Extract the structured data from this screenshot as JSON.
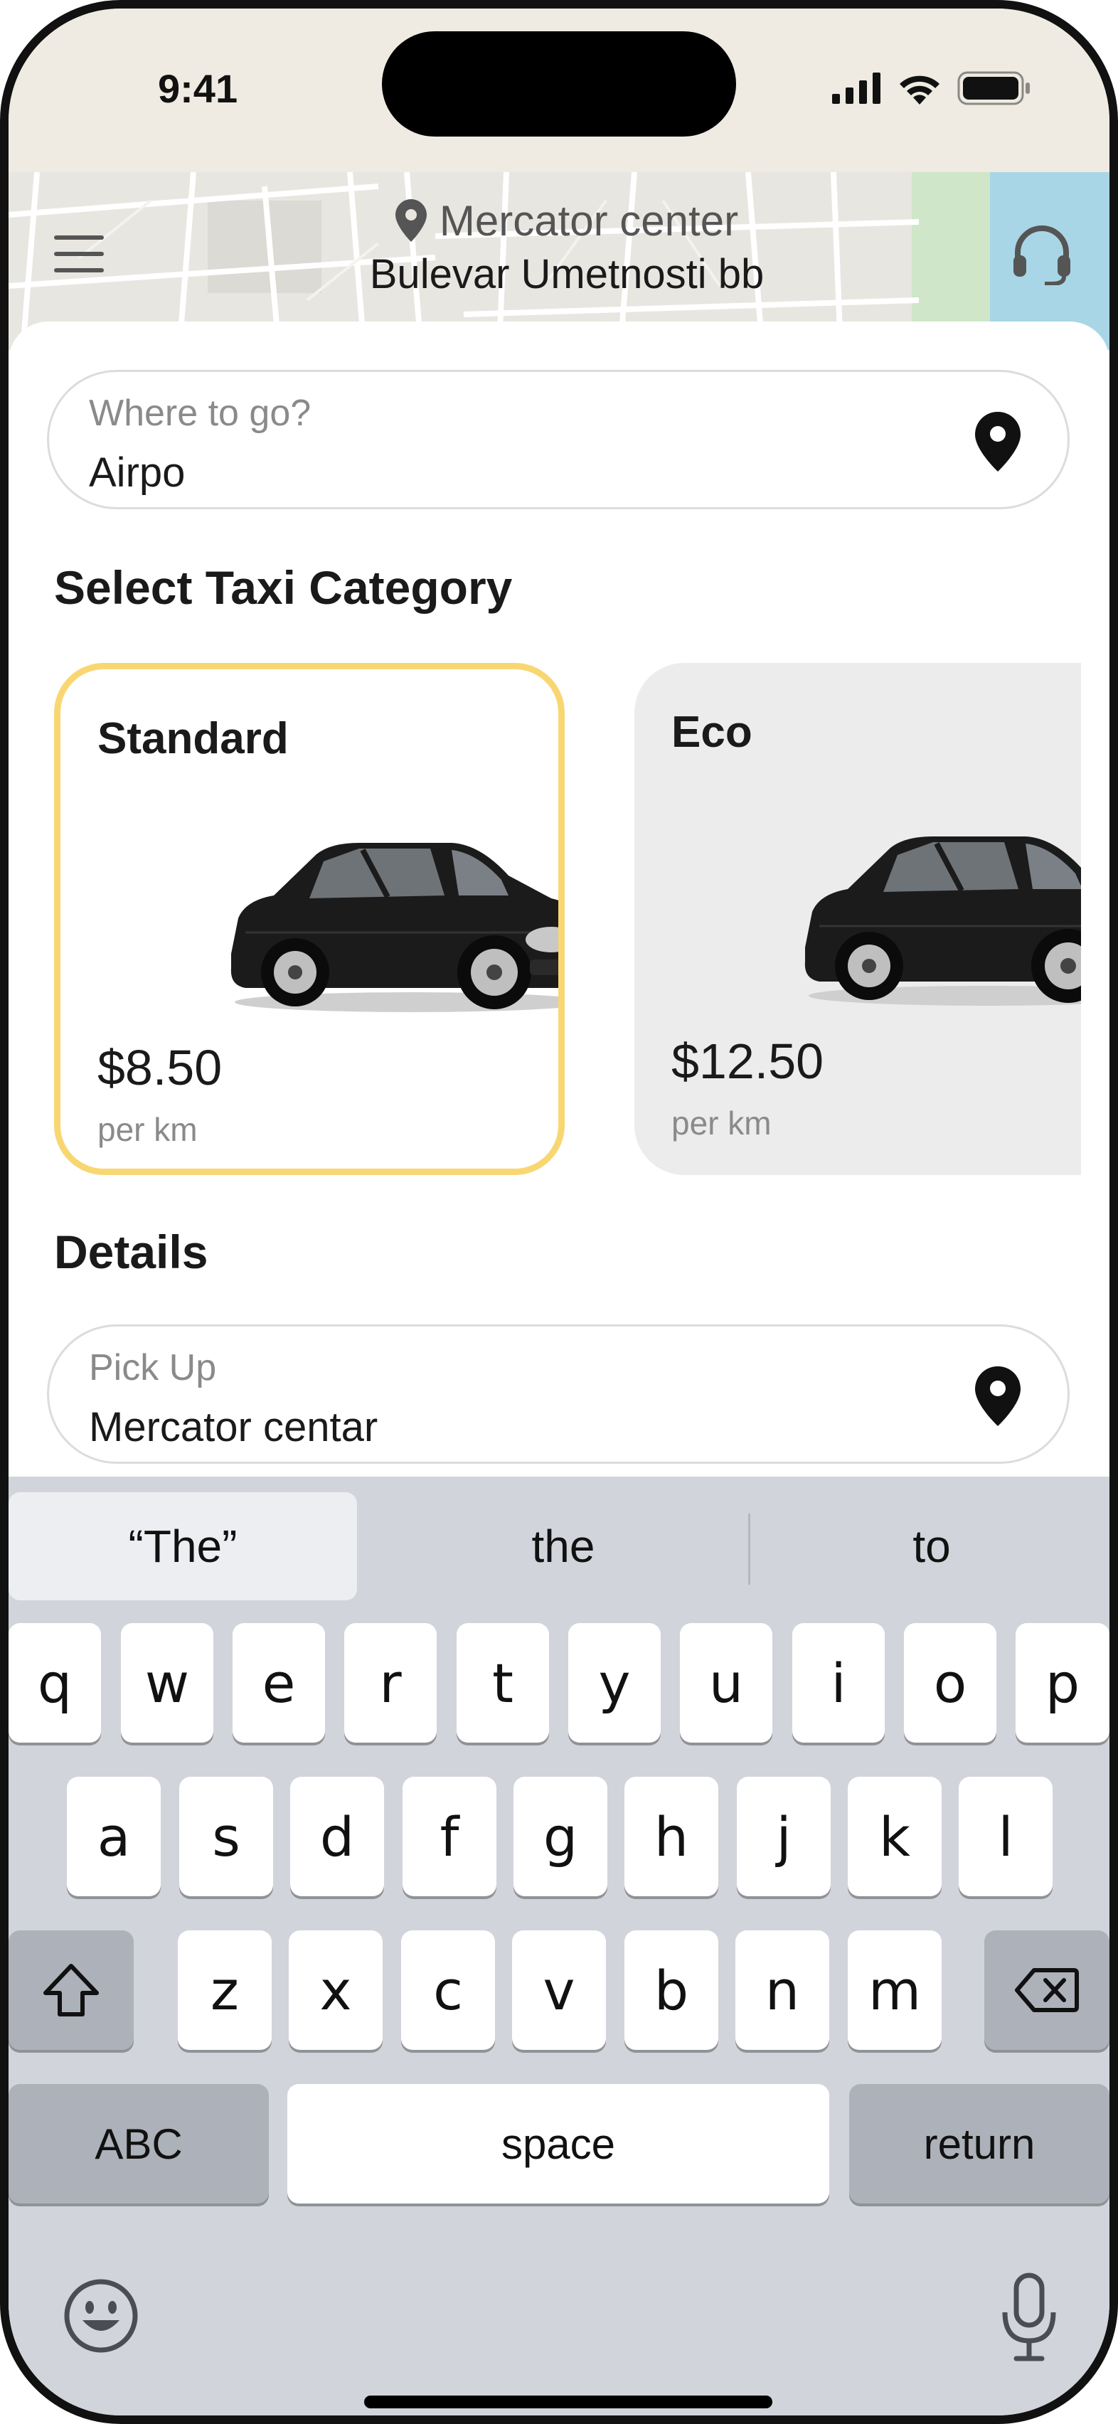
{
  "status_bar": {
    "time": "9:41"
  },
  "header": {
    "location_name": "Mercator center",
    "address": "Bulevar Umetnosti bb"
  },
  "destination": {
    "placeholder": "Where to go?",
    "value": "Airpo"
  },
  "categories": {
    "title": "Select Taxi Category",
    "items": [
      {
        "name": "Standard",
        "price": "$8.50",
        "unit": "per km",
        "selected": true
      },
      {
        "name": "Eco",
        "price": "$12.50",
        "unit": "per km",
        "selected": false
      }
    ]
  },
  "details": {
    "title": "Details",
    "pickup_label": "Pick Up",
    "pickup_value": "Mercator centar"
  },
  "keyboard": {
    "suggestions": [
      "“The”",
      "the",
      "to"
    ],
    "row1": [
      "q",
      "w",
      "e",
      "r",
      "t",
      "y",
      "u",
      "i",
      "o",
      "p"
    ],
    "row2": [
      "a",
      "s",
      "d",
      "f",
      "g",
      "h",
      "j",
      "k",
      "l"
    ],
    "row3": [
      "z",
      "x",
      "c",
      "v",
      "b",
      "n",
      "m"
    ],
    "abc_label": "ABC",
    "space_label": "space",
    "return_label": "return"
  },
  "colors": {
    "selected_border": "#f8d773",
    "card_gray": "#ececec",
    "keyboard_bg": "#d1d4da"
  },
  "icons": {
    "menu": "menu-icon",
    "support": "headset-icon",
    "pin": "location-pin-icon",
    "shift": "shift-icon",
    "delete": "backspace-icon",
    "emoji": "emoji-icon",
    "mic": "microphone-icon"
  }
}
